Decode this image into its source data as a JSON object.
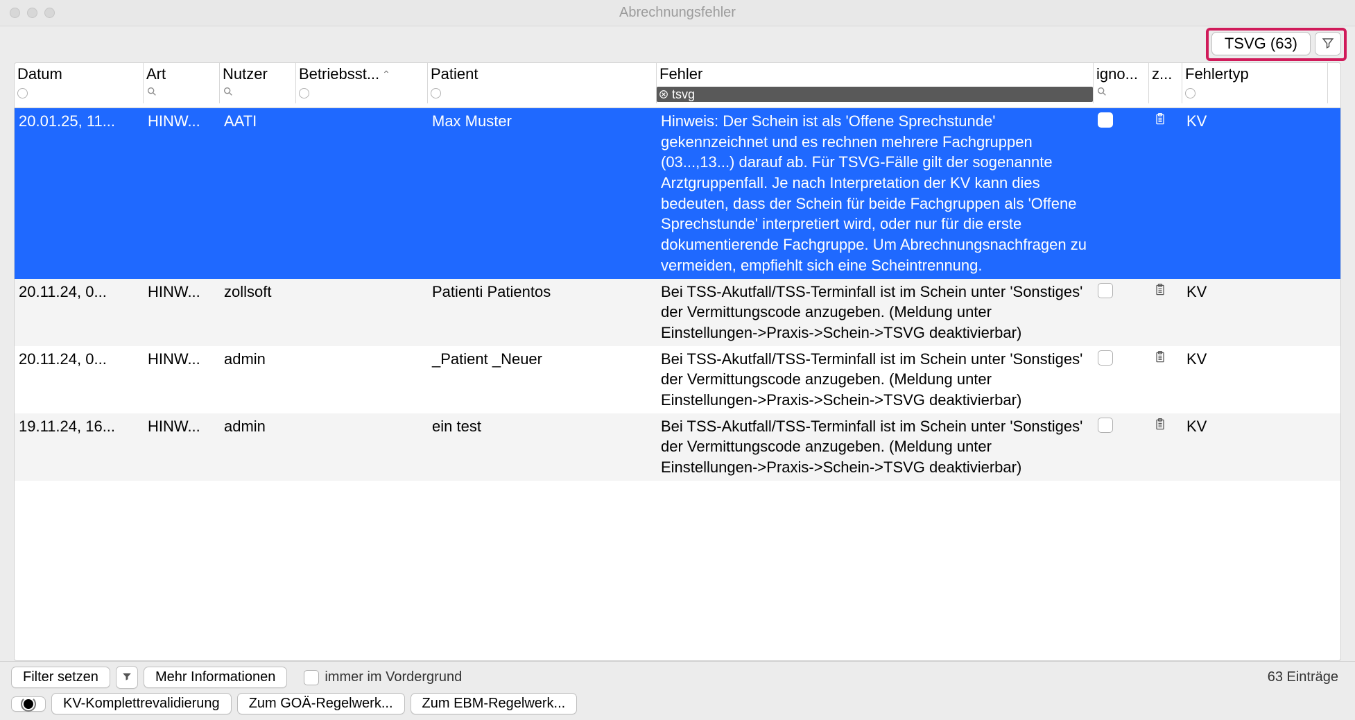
{
  "window": {
    "title": "Abrechnungsfehler"
  },
  "toolbar": {
    "filter_badge_label": "TSVG (63)"
  },
  "columns": {
    "datum": "Datum",
    "art": "Art",
    "nutzer": "Nutzer",
    "betriebsst": "Betriebsst...",
    "patient": "Patient",
    "fehler": "Fehler",
    "igno": "igno...",
    "z": "z...",
    "fehlertyp": "Fehlertyp"
  },
  "filters": {
    "fehler_active_value": "tsvg"
  },
  "rows": [
    {
      "datum": "20.01.25, 11...",
      "art": "HINW...",
      "nutzer": "AATI",
      "betriebsst": "",
      "patient": "Max Muster",
      "fehler": "Hinweis: Der Schein ist als 'Offene Sprechstunde' gekennzeichnet und es rechnen mehrere Fachgruppen (03...,13...) darauf ab. Für TSVG-Fälle gilt der sogenannte Arztgruppenfall. Je nach Interpretation der KV kann dies bedeuten, dass der Schein für beide Fachgruppen als 'Offene Sprechstunde' interpretiert wird, oder nur für die erste dokumentierende Fachgruppe. Um Abrechnungsnachfragen zu vermeiden, empfiehlt sich eine Scheintrennung.",
      "fehlertyp": "KV",
      "selected": true
    },
    {
      "datum": "20.11.24, 0...",
      "art": "HINW...",
      "nutzer": "zollsoft",
      "betriebsst": "",
      "patient": "Patienti Patientos",
      "fehler": "Bei TSS-Akutfall/TSS-Terminfall ist im Schein unter 'Sonstiges' der Vermittungscode anzugeben. (Meldung unter Einstellungen->Praxis->Schein->TSVG deaktivierbar)",
      "fehlertyp": "KV",
      "selected": false
    },
    {
      "datum": "20.11.24, 0...",
      "art": "HINW...",
      "nutzer": "admin",
      "betriebsst": "",
      "patient": "_Patient _Neuer",
      "fehler": "Bei TSS-Akutfall/TSS-Terminfall ist im Schein unter 'Sonstiges' der Vermittungscode anzugeben. (Meldung unter Einstellungen->Praxis->Schein->TSVG deaktivierbar)",
      "fehlertyp": "KV",
      "selected": false
    },
    {
      "datum": "19.11.24, 16...",
      "art": "HINW...",
      "nutzer": "admin",
      "betriebsst": "",
      "patient": "ein test",
      "fehler": "Bei TSS-Akutfall/TSS-Terminfall ist im Schein unter 'Sonstiges' der Vermittungscode anzugeben. (Meldung unter Einstellungen->Praxis->Schein->TSVG deaktivierbar)",
      "fehlertyp": "KV",
      "selected": false
    }
  ],
  "bottom": {
    "filter_setzen": "Filter setzen",
    "mehr_info": "Mehr Informationen",
    "immer_vordergrund": "immer im Vordergrund",
    "count": "63 Einträge",
    "kv_revalid": "KV-Komplettrevalidierung",
    "zum_goa": "Zum GOÄ-Regelwerk...",
    "zum_ebm": "Zum EBM-Regelwerk..."
  }
}
